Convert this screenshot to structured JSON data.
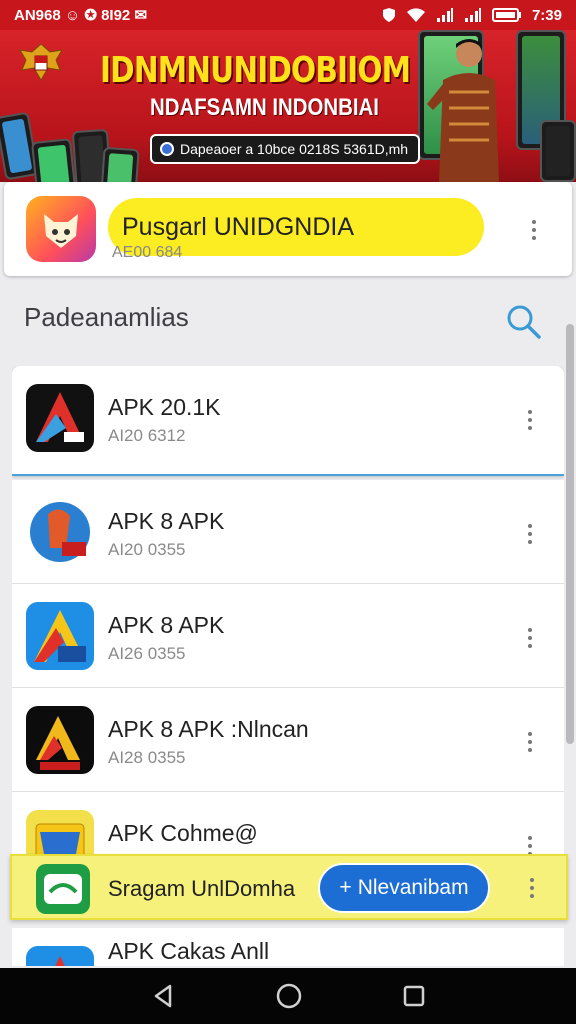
{
  "status_bar": {
    "left_text": "AN968 ☺ ✪ 8I92 ✉",
    "time": "7:39"
  },
  "banner": {
    "title": "IDNMNUNIDOBIIOM",
    "subtitle": "NDAFSAMN INDONBIAI",
    "pill_text": "Dapeaoer a 10bce 0218S 5361D,mh"
  },
  "featured": {
    "title": "Pusgarl UNIDGNDIA",
    "subtitle": "AE00 684"
  },
  "section": {
    "title": "Padeanamlias"
  },
  "apps": [
    {
      "name": "APK 20.1K",
      "subtitle": "AI20 6312"
    },
    {
      "name": "APK 8 APK",
      "subtitle": "AI20 0355"
    },
    {
      "name": "APK 8 APK",
      "subtitle": "AI26 0355"
    },
    {
      "name": "APK 8 APK :Nlncan",
      "subtitle": "AI28 0355"
    },
    {
      "name": "APK Cohme@",
      "subtitle": ""
    },
    {
      "name": "APK Cakas Anll",
      "subtitle": ""
    }
  ],
  "install_bar": {
    "text": "Sragam UnlDomha",
    "button_label": "Nlevanibam",
    "button_icon": "+"
  },
  "colors": {
    "brand_red": "#c8161d",
    "accent_yellow": "#fcec22",
    "accent_blue": "#1c6ed4"
  },
  "icons": [
    "emblem-icon",
    "search-icon",
    "more-vert-icon",
    "back-icon",
    "home-icon",
    "recents-icon"
  ]
}
